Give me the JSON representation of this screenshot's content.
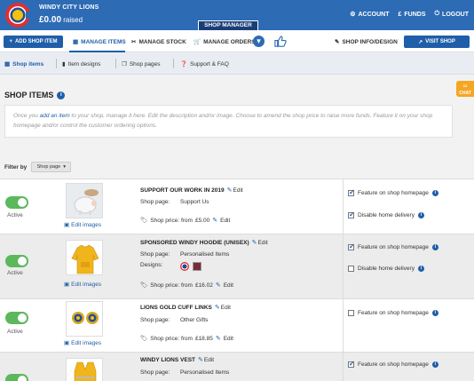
{
  "header": {
    "org_name": "WINDY CITY LIONS",
    "raised_amount": "£0.00",
    "raised_label": "raised",
    "shop_manager_tab": "SHOP MANAGER",
    "links": [
      {
        "label": "ACCOUNT",
        "icon": "gear-icon"
      },
      {
        "label": "FUNDS",
        "icon": "pound-icon"
      },
      {
        "label": "LOGOUT",
        "icon": "logout-icon"
      }
    ]
  },
  "nav": {
    "add_button": "ADD SHOP ITEM",
    "manage_items": "MANAGE ITEMS",
    "manage_stock": "MANAGE STOCK",
    "manage_orders": "MANAGE ORDERS",
    "shop_info": "SHOP INFO/DESIGN",
    "visit_shop": "VISIT SHOP"
  },
  "subnav": {
    "shop_items": "Shop items",
    "item_designs": "Item designs",
    "shop_pages": "Shop pages",
    "support": "Support & FAQ"
  },
  "main": {
    "title": "SHOP ITEMS",
    "description_pre": "Once you ",
    "description_link": "add an item",
    "description_post": " to your shop, manage it here. Edit the description and/or image. Choose to amend the shop price to raise more funds. Feature it on your shop homepage and/or control the customer ordering options.",
    "chat_label": "CHAT",
    "filter_label": "Filter by",
    "filter_value": "Shop page"
  },
  "labels": {
    "active": "Active",
    "edit_images": "Edit images",
    "edit": "Edit",
    "shop_page": "Shop page:",
    "designs": "Designs:",
    "shop_price_from": "Shop price: from",
    "feature": "Feature on shop homepage",
    "disable_delivery": "Disable home delivery"
  },
  "items": [
    {
      "name": "SUPPORT OUR WORK IN 2019",
      "shop_page": "Support Us",
      "price": "£5.00",
      "active": true,
      "feature": true,
      "disable_delivery": true
    },
    {
      "name": "SPONSORED WINDY HOODIE (UNISEX)",
      "shop_page": "Personalised Items",
      "price": "£16.02",
      "active": true,
      "feature": true,
      "disable_delivery": false
    },
    {
      "name": "LIONS GOLD CUFF LINKS",
      "shop_page": "Other Gifts",
      "price": "£18.85",
      "active": true,
      "feature": false,
      "disable_delivery": null
    },
    {
      "name": "WINDY LIONS VEST",
      "shop_page": "Personalised Items",
      "price": "",
      "active": true,
      "feature": true,
      "disable_delivery": null
    }
  ],
  "colors": {
    "brand_blue": "#2d6bb5",
    "toggle_green": "#5cb85c",
    "chat_orange": "#f5a623"
  }
}
